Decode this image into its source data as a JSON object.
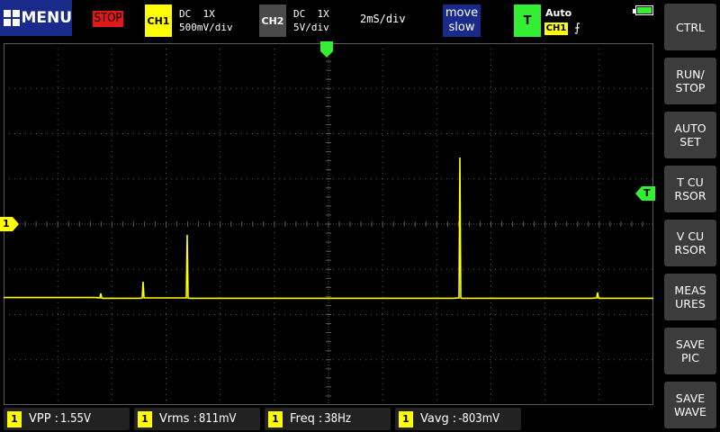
{
  "topbar": {
    "menu_label": "MENU",
    "run_state": "STOP",
    "ch1": {
      "label": "CH1",
      "coupling": "DC",
      "probe": "1X",
      "scale": "500mV/div"
    },
    "ch2": {
      "label": "CH2",
      "coupling": "DC",
      "probe": "1X",
      "scale": "5V/div"
    },
    "timebase": "2mS/div",
    "move_line1": "move",
    "move_line2": "slow",
    "trigger": {
      "label": "T",
      "mode": "Auto",
      "source": "CH1",
      "edge": "⨍"
    }
  },
  "sidebar": {
    "items": [
      {
        "label": "CTRL"
      },
      {
        "label": "RUN/\nSTOP"
      },
      {
        "label": "AUTO\nSET"
      },
      {
        "label": "T CU\nRSOR"
      },
      {
        "label": "V CU\nRSOR"
      },
      {
        "label": "MEAS\nURES"
      },
      {
        "label": "SAVE\nPIC"
      },
      {
        "label": "SAVE\nWAVE"
      }
    ]
  },
  "markers": {
    "ch1": "1",
    "trigger": "T"
  },
  "measurements": [
    {
      "ch": "1",
      "name": "VPP",
      "value": "1.55V"
    },
    {
      "ch": "1",
      "name": "Vrms",
      "value": "811mV"
    },
    {
      "ch": "1",
      "name": "Freq",
      "value": "38Hz"
    },
    {
      "ch": "1",
      "name": "Vavg",
      "value": "-803mV"
    }
  ],
  "colors": {
    "trace": "#ffff00",
    "grid": "#5a5a5a",
    "trigger_marker": "#33ee33",
    "stop": "#e01818"
  }
}
